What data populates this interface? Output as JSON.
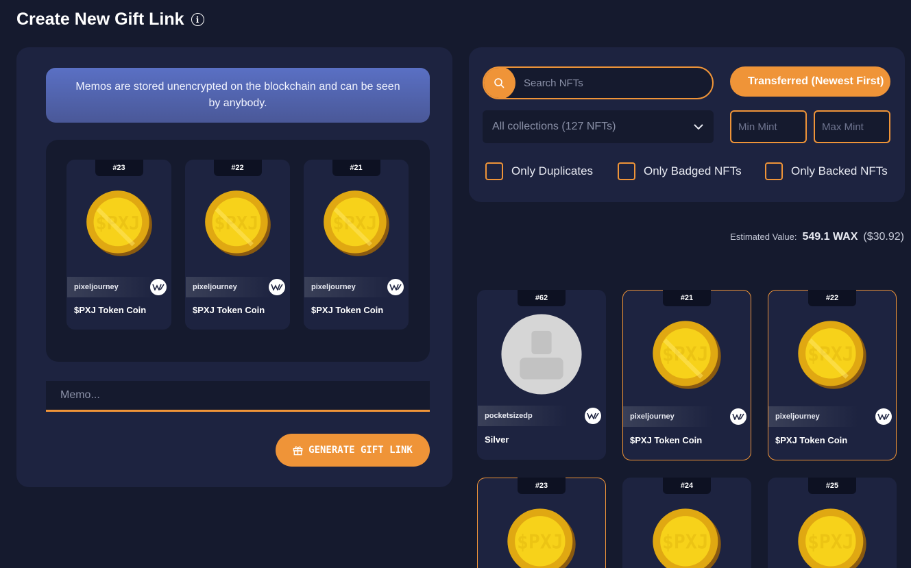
{
  "page": {
    "title": "Create New Gift Link"
  },
  "memo_notice": "Memos are stored unencrypted on the blockchain and can be seen by anybody.",
  "selected_nfts": [
    {
      "mint": "#23",
      "collection": "pixeljourney",
      "name": "$PXJ Token Coin",
      "art": "gold-coin"
    },
    {
      "mint": "#22",
      "collection": "pixeljourney",
      "name": "$PXJ Token Coin",
      "art": "gold-coin"
    },
    {
      "mint": "#21",
      "collection": "pixeljourney",
      "name": "$PXJ Token Coin",
      "art": "gold-coin"
    }
  ],
  "memo": {
    "placeholder": "Memo...",
    "value": ""
  },
  "generate_button": {
    "label": "GENERATE GIFT LINK",
    "icon": "gift-icon"
  },
  "filters": {
    "search_placeholder": "Search NFTs",
    "sort_label": "Transferred (Newest First)",
    "collection_select": "All collections (127 NFTs)",
    "min_mint_placeholder": "Min Mint",
    "max_mint_placeholder": "Max Mint",
    "checkboxes": [
      "Only Duplicates",
      "Only Badged NFTs",
      "Only Backed NFTs"
    ]
  },
  "estimated_value": {
    "label": "Estimated Value:",
    "wax": "549.1 WAX",
    "usd": "($30.92)"
  },
  "inventory": [
    {
      "mint": "#62",
      "collection": "pocketsizedp",
      "name": "Silver",
      "art": "placeholder-avatar",
      "selected": false
    },
    {
      "mint": "#21",
      "collection": "pixeljourney",
      "name": "$PXJ Token Coin",
      "art": "gold-coin",
      "selected": true
    },
    {
      "mint": "#22",
      "collection": "pixeljourney",
      "name": "$PXJ Token Coin",
      "art": "gold-coin",
      "selected": true
    },
    {
      "mint": "#23",
      "collection": "",
      "name": "",
      "art": "gold-coin",
      "selected": true
    },
    {
      "mint": "#24",
      "collection": "",
      "name": "",
      "art": "gold-coin",
      "selected": false
    },
    {
      "mint": "#25",
      "collection": "",
      "name": "",
      "art": "gold-coin",
      "selected": false
    }
  ],
  "colors": {
    "accent": "#ef9438",
    "background": "#151a2e",
    "panel": "#1d2340",
    "notice": "#5a70c4"
  }
}
